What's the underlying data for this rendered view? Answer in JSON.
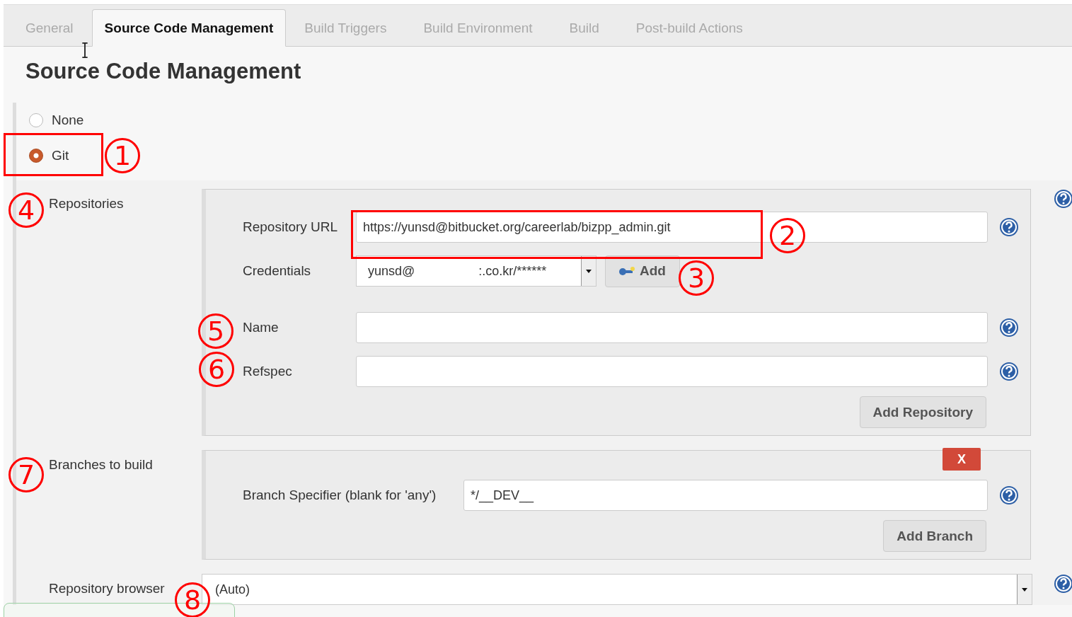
{
  "tabs": [
    {
      "label": "General",
      "selected": false
    },
    {
      "label": "Source Code Management",
      "selected": true
    },
    {
      "label": "Build Triggers",
      "selected": false
    },
    {
      "label": "Build Environment",
      "selected": false
    },
    {
      "label": "Build",
      "selected": false
    },
    {
      "label": "Post-build Actions",
      "selected": false
    }
  ],
  "heading": "Source Code Management",
  "scm_options": [
    {
      "label": "None",
      "selected": false
    },
    {
      "label": "Git",
      "selected": true
    }
  ],
  "repositories": {
    "label": "Repositories",
    "fields": [
      {
        "kind": "text",
        "label": "Repository URL",
        "value": "https://yunsd@bitbucket.org/careerlab/bizpp_admin.git"
      },
      {
        "kind": "credentials",
        "label": "Credentials",
        "value_start": "yunsd@",
        "value_end": ":.co.kr/******",
        "button": "Add"
      },
      {
        "kind": "text",
        "label": "Name"
      },
      {
        "kind": "text",
        "label": "Refspec"
      }
    ],
    "add_button": "Add Repository"
  },
  "branches": {
    "label": "Branches to build",
    "delete_button": "X",
    "specifier_label": "Branch Specifier (blank for 'any')",
    "specifier_value": "*/__DEV__",
    "add_button": "Add Branch"
  },
  "repository_browser": {
    "label": "Repository browser",
    "value": "(Auto)"
  },
  "annotations": [
    "1",
    "2",
    "3",
    "4",
    "5",
    "6",
    "7",
    "8"
  ]
}
